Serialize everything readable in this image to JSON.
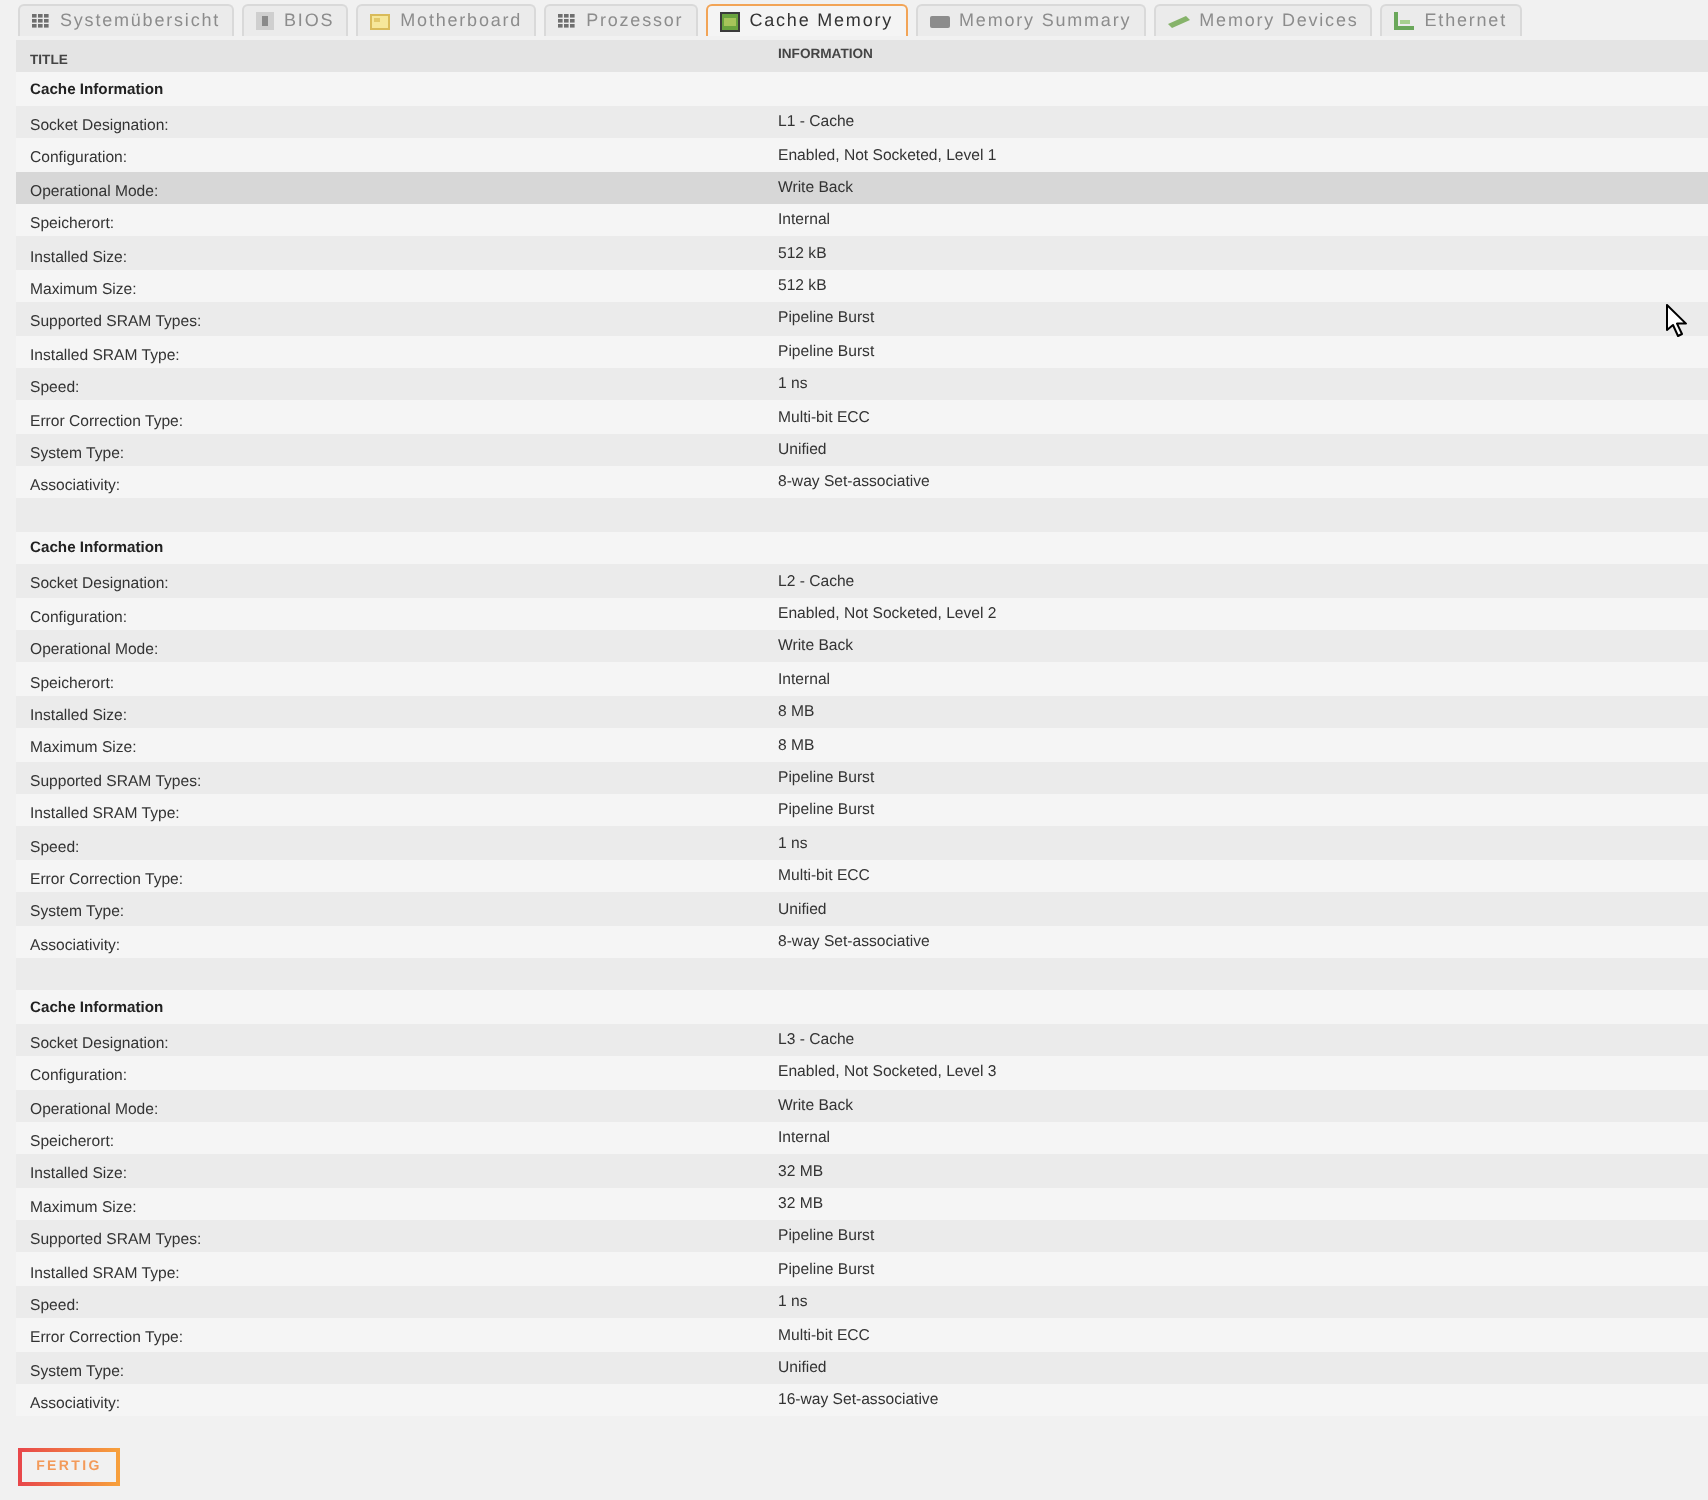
{
  "tabs": [
    {
      "label": "Systemübersicht",
      "kind": "overview",
      "selected": false
    },
    {
      "label": "BIOS",
      "kind": "bios",
      "selected": false
    },
    {
      "label": "Motherboard",
      "kind": "board",
      "selected": false
    },
    {
      "label": "Prozessor",
      "kind": "cpu",
      "selected": false
    },
    {
      "label": "Cache Memory",
      "kind": "cache",
      "selected": true
    },
    {
      "label": "Memory Summary",
      "kind": "summary",
      "selected": false
    },
    {
      "label": "Memory Devices",
      "kind": "devices",
      "selected": false
    },
    {
      "label": "Ethernet",
      "kind": "network",
      "selected": false
    }
  ],
  "table": {
    "columns": [
      "TITLE",
      "INFORMATION"
    ],
    "sections": [
      {
        "heading": "Cache Information",
        "rows": [
          {
            "title": "Socket Designation:",
            "information": "L1 - Cache",
            "selected": false
          },
          {
            "title": "Configuration:",
            "information": "Enabled, Not Socketed, Level 1",
            "selected": false
          },
          {
            "title": "Operational Mode:",
            "information": "Write Back",
            "selected": true
          },
          {
            "title": "Speicherort:",
            "information": "Internal",
            "selected": false
          },
          {
            "title": "Installed Size:",
            "information": "512 kB",
            "selected": false
          },
          {
            "title": "Maximum Size:",
            "information": "512 kB",
            "selected": false
          },
          {
            "title": "Supported SRAM Types:",
            "information": "Pipeline Burst",
            "selected": false
          },
          {
            "title": "Installed SRAM Type:",
            "information": "Pipeline Burst",
            "selected": false
          },
          {
            "title": "Speed:",
            "information": "1 ns",
            "selected": false
          },
          {
            "title": "Error Correction Type:",
            "information": "Multi-bit ECC",
            "selected": false
          },
          {
            "title": "System Type:",
            "information": "Unified",
            "selected": false
          },
          {
            "title": "Associativity:",
            "information": "8-way Set-associative",
            "selected": false
          }
        ]
      },
      {
        "heading": "Cache Information",
        "rows": [
          {
            "title": "Socket Designation:",
            "information": "L2 - Cache",
            "selected": false
          },
          {
            "title": "Configuration:",
            "information": "Enabled, Not Socketed, Level 2",
            "selected": false
          },
          {
            "title": "Operational Mode:",
            "information": "Write Back",
            "selected": false
          },
          {
            "title": "Speicherort:",
            "information": "Internal",
            "selected": false
          },
          {
            "title": "Installed Size:",
            "information": "8 MB",
            "selected": false
          },
          {
            "title": "Maximum Size:",
            "information": "8 MB",
            "selected": false
          },
          {
            "title": "Supported SRAM Types:",
            "information": "Pipeline Burst",
            "selected": false
          },
          {
            "title": "Installed SRAM Type:",
            "information": "Pipeline Burst",
            "selected": false
          },
          {
            "title": "Speed:",
            "information": "1 ns",
            "selected": false
          },
          {
            "title": "Error Correction Type:",
            "information": "Multi-bit ECC",
            "selected": false
          },
          {
            "title": "System Type:",
            "information": "Unified",
            "selected": false
          },
          {
            "title": "Associativity:",
            "information": "8-way Set-associative",
            "selected": false
          }
        ]
      },
      {
        "heading": "Cache Information",
        "rows": [
          {
            "title": "Socket Designation:",
            "information": "L3 - Cache",
            "selected": false
          },
          {
            "title": "Configuration:",
            "information": "Enabled, Not Socketed, Level 3",
            "selected": false
          },
          {
            "title": "Operational Mode:",
            "information": "Write Back",
            "selected": false
          },
          {
            "title": "Speicherort:",
            "information": "Internal",
            "selected": false
          },
          {
            "title": "Installed Size:",
            "information": "32 MB",
            "selected": false
          },
          {
            "title": "Maximum Size:",
            "information": "32 MB",
            "selected": false
          },
          {
            "title": "Supported SRAM Types:",
            "information": "Pipeline Burst",
            "selected": false
          },
          {
            "title": "Installed SRAM Type:",
            "information": "Pipeline Burst",
            "selected": false
          },
          {
            "title": "Speed:",
            "information": "1 ns",
            "selected": false
          },
          {
            "title": "Error Correction Type:",
            "information": "Multi-bit ECC",
            "selected": false
          },
          {
            "title": "System Type:",
            "information": "Unified",
            "selected": false
          },
          {
            "title": "Associativity:",
            "information": "16-way Set-associative",
            "selected": false
          }
        ]
      }
    ]
  },
  "button": {
    "label": "FERTIG"
  }
}
